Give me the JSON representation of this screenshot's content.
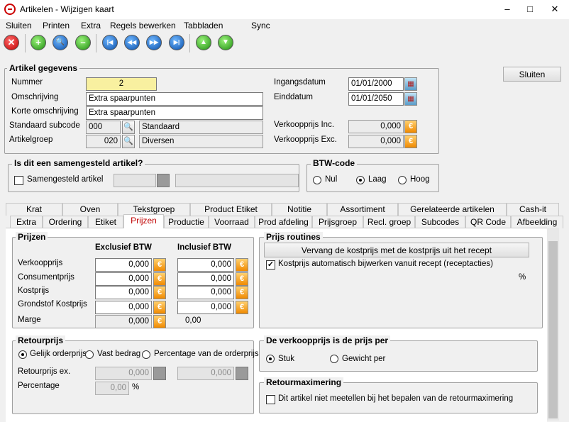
{
  "window": {
    "title": "Artikelen - Wijzigen kaart",
    "min": "–",
    "max": "□",
    "close": "✕"
  },
  "menu": [
    "Sluiten",
    "Printen",
    "Extra",
    "Regels bewerken",
    "Tabbladen",
    "Sync"
  ],
  "toolbar": {
    "cancel": "✕",
    "add": "+",
    "search": "🔍",
    "remove": "–",
    "first": "|◀",
    "prev": "◀◀",
    "next": "▶▶",
    "last": "▶|",
    "up": "▲",
    "down": "▼"
  },
  "close_button": "Sluiten",
  "artikel": {
    "title": "Artikel gegevens",
    "nummer_label": "Nummer",
    "nummer": "2",
    "omschrijving_label": "Omschrijving",
    "omschrijving": "Extra spaarpunten",
    "korte_label": "Korte omschrijving",
    "korte": "Extra spaarpunten",
    "subcode_label": "Standaard subcode",
    "subcode": "000",
    "subcode_name": "Standaard",
    "groep_label": "Artikelgroep",
    "groep": "020",
    "groep_name": "Diversen",
    "ingang_label": "Ingangsdatum",
    "ingang": "01/01/2000",
    "eind_label": "Einddatum",
    "eind": "01/01/2050",
    "vk_inc_label": "Verkoopprijs Inc.",
    "vk_inc": "0,000",
    "vk_exc_label": "Verkoopprijs Exc.",
    "vk_exc": "0,000"
  },
  "samengesteld": {
    "title": "Is dit een samengesteld artikel?",
    "checkbox": "Samengesteld artikel"
  },
  "btw": {
    "title": "BTW-code",
    "options": [
      "Nul",
      "Laag",
      "Hoog"
    ],
    "selected": "Laag"
  },
  "tabs_row1": [
    "Krat",
    "Oven",
    "Tekstgroep",
    "Product Etiket",
    "Notitie",
    "Assortiment",
    "Gerelateerde artikelen",
    "Cash-it"
  ],
  "tabs_row2": [
    "Extra",
    "Ordering",
    "Etiket",
    "Prijzen",
    "Productie",
    "Voorraad",
    "Prod afdeling",
    "Prijsgroep",
    "Recl. groep",
    "Subcodes",
    "QR Code",
    "Afbeelding"
  ],
  "active_tab": "Prijzen",
  "prijzen": {
    "title": "Prijzen",
    "col_excl": "Exclusief BTW",
    "col_incl": "Inclusief BTW",
    "rows": [
      {
        "label": "Verkoopprijs",
        "excl": "0,000",
        "incl": "0,000"
      },
      {
        "label": "Consumentprijs",
        "excl": "0,000",
        "incl": "0,000"
      },
      {
        "label": "Kostprijs",
        "excl": "0,000",
        "incl": "0,000"
      },
      {
        "label": "Grondstof Kostprijs",
        "excl": "0,000",
        "incl": "0,000"
      }
    ],
    "marge_label": "Marge",
    "marge_excl": "0,000",
    "marge_incl": "0,00"
  },
  "routines": {
    "title": "Prijs routines",
    "button": "Vervang de kostprijs met de kostprijs uit het recept",
    "checkbox": "Kostprijs automatisch bijwerken vanuit recept (receptacties)",
    "percent": "%"
  },
  "retour": {
    "title": "Retourprijs",
    "options": [
      "Gelijk orderprijs",
      "Vast bedrag",
      "Percentage van de orderprijs"
    ],
    "selected": "Gelijk orderprijs",
    "ex_label": "Retourprijs ex.",
    "ex_value": "0,000",
    "inc_value": "0,000",
    "pct_label": "Percentage",
    "pct_value": "0,00",
    "pct_unit": "%"
  },
  "prijsper": {
    "title": "De verkoopprijs is de prijs per",
    "options": [
      "Stuk",
      "Gewicht per"
    ],
    "selected": "Stuk"
  },
  "retourmax": {
    "title": "Retourmaximering",
    "checkbox": "Dit artikel niet meetellen bij het bepalen van de retourmaximering"
  },
  "icons": {
    "euro": "€",
    "search": "🔍",
    "calendar": "▦"
  }
}
